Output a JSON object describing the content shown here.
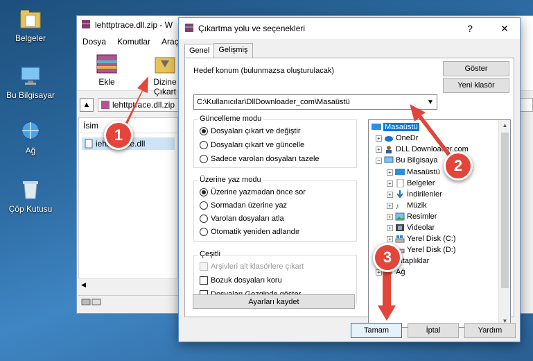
{
  "desktop": {
    "icons": [
      {
        "label": "Belgeler"
      },
      {
        "label": "Bu Bilgisayar"
      },
      {
        "label": "Ağ"
      },
      {
        "label": "Çöp Kutusu"
      }
    ]
  },
  "winrar": {
    "title": "lehttptrace.dll.zip - W",
    "menu": [
      "Dosya",
      "Komutlar",
      "Araçla"
    ],
    "toolbar": {
      "add_label": "Ekle",
      "extract_label": "Dizine Çıkart"
    },
    "address": "lehttptrace.dll.zip",
    "list_header": "İsim",
    "file_row": "iehttptrace.dll"
  },
  "dialog": {
    "title": "Çıkartma yolu ve seçenekleri",
    "help_glyph": "?",
    "close_glyph": "✕",
    "tabs": [
      "Genel",
      "Gelişmiş"
    ],
    "dest_label": "Hedef konum (bulunmazsa oluşturulacak)",
    "dest_value": "C:\\Kullanıcılar\\DllDownloader_com\\Masaüstü",
    "show_button": "Göster",
    "new_folder_button": "Yeni klasör",
    "update_group": {
      "title": "Güncelleme modu",
      "options": [
        "Dosyaları çıkart ve değiştir",
        "Dosyaları çıkart ve güncelle",
        "Sadece varolan dosyaları tazele"
      ],
      "selected": 0
    },
    "overwrite_group": {
      "title": "Üzerine yaz modu",
      "options": [
        "Üzerine yazmadan önce sor",
        "Sormadan üzerine yaz",
        "Varolan dosyaları atla",
        "Otomatik yeniden adlandır"
      ],
      "selected": 0
    },
    "misc_group": {
      "title": "Çeşitli",
      "options": [
        "Arşivleri alt klasörlere çıkart",
        "Bozuk dosyaları koru",
        "Dosyaları Gezginde göster"
      ]
    },
    "save_settings_button": "Ayarları kaydet",
    "tree": [
      {
        "label": "Masaüstü",
        "selected": true
      },
      {
        "label": "OneDr"
      },
      {
        "label": "DLL Downloader.com"
      },
      {
        "label": "Bu Bilgisaya"
      },
      {
        "label": "Masaüstü"
      },
      {
        "label": "Belgeler"
      },
      {
        "label": "İndirilenler"
      },
      {
        "label": "Müzik"
      },
      {
        "label": "Resimler"
      },
      {
        "label": "Videolar"
      },
      {
        "label": "Yerel Disk (C:)"
      },
      {
        "label": "Yerel Disk (D:)"
      },
      {
        "label": "Kitaplıklar"
      },
      {
        "label": "Ağ"
      }
    ],
    "ok_button": "Tamam",
    "cancel_button": "İptal",
    "help_button": "Yardım"
  },
  "annotations": {
    "step1": "1",
    "step2": "2",
    "step3": "3"
  },
  "colors": {
    "annotation": "#e2463a",
    "selection": "#0078d7"
  }
}
